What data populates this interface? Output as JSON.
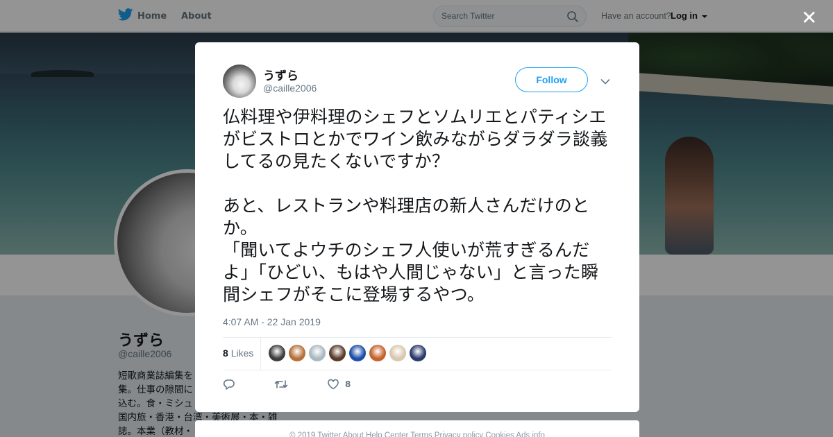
{
  "nav": {
    "home_label": "Home",
    "about_label": "About",
    "search_placeholder": "Search Twitter",
    "account_prompt": "Have an account?",
    "login_label": "Log in"
  },
  "profile": {
    "name": "うずら",
    "handle": "@caille2006",
    "bio": "短歌商業誌編集を\n集。仕事の隙間に\n込む。食・ミシュ\n国内旅・香港・台湾・美術展・本・雑\n誌。本業（教材・"
  },
  "tweet": {
    "name": "うずら",
    "handle": "@caille2006",
    "follow_label": "Follow",
    "text": "仏料理や伊料理のシェフとソムリエとパティシエがビストロとかでワイン飲みながらダラダラ談義してるの見たくないですか？\n\nあと、レストランや料理店の新人さんだけのとか。\n「聞いてよウチのシェフ人使いが荒すぎるんだよ」「ひどい、もはや人間じゃない」と言った瞬間シェフがそこに登場するやつ。",
    "timestamp": "4:07 AM - 22 Jan 2019",
    "likes_count": "8",
    "likes_label": "Likes",
    "like_action_count": "8"
  },
  "likers": [
    {
      "color": "#3d3d3d"
    },
    {
      "color": "#b5703a"
    },
    {
      "color": "#aab8c2"
    },
    {
      "color": "#5a3b2a"
    },
    {
      "color": "#1c4fa8"
    },
    {
      "color": "#c4622a"
    },
    {
      "color": "#d8c8b0"
    },
    {
      "color": "#2a3a6a"
    }
  ],
  "footer": {
    "text": "© 2019 Twitter   About   Help Center   Terms   Privacy policy   Cookies   Ads info"
  },
  "colors": {
    "accent": "#1da1f2",
    "secondary_text": "#657786"
  }
}
